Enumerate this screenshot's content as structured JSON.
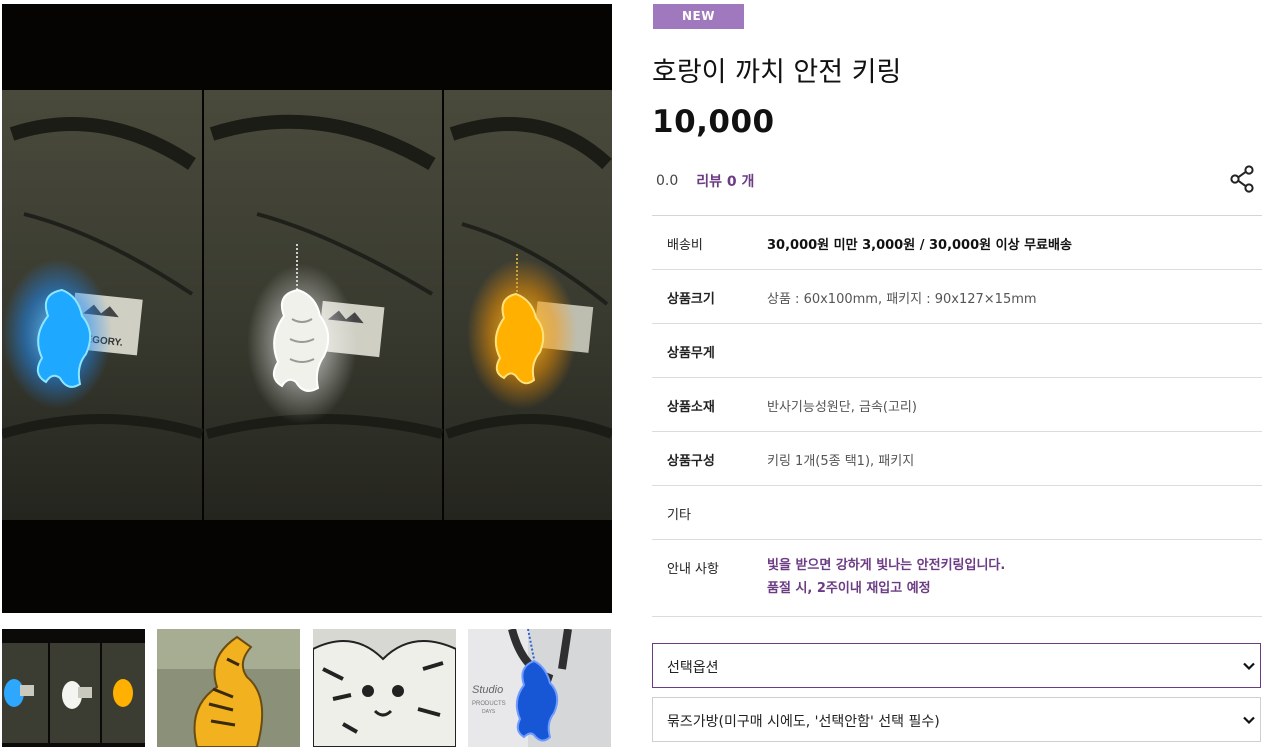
{
  "product": {
    "badge": "NEW",
    "title": "호랑이 까치 안전 키링",
    "price": "10,000",
    "rating": "0.0",
    "review_label": "리뷰 0 개"
  },
  "specs": [
    {
      "label": "배송비",
      "value": "30,000원 미만 3,000원 / 30,000원 이상 무료배송"
    },
    {
      "label": "상품크기",
      "value": "상품 : 60x100mm, 패키지 : 90x127×15mm"
    },
    {
      "label": "상품무게",
      "value": ""
    },
    {
      "label": "상품소재",
      "value": "반사기능성원단, 금속(고리)"
    },
    {
      "label": "상품구성",
      "value": "키링 1개(5종 택1), 패키지"
    },
    {
      "label": "기타",
      "value": ""
    },
    {
      "label": "안내 사항",
      "value_line1": "빛을 받으면 강하게 빛나는 안전키링입니다.",
      "value_line2": "품절 시, 2주이내 재입고 예정"
    }
  ],
  "options": {
    "select_option": "선택옵션",
    "select_bag": "묶즈가방(미구매 시에도, '선택안함' 선택 필수)"
  },
  "photo": {
    "bag_logo": "REGORY.",
    "thumb4_text_1": "Studio",
    "thumb4_text_2": "PRODUCTS",
    "thumb4_text_3": "DAYS"
  },
  "icons": {
    "share": "share-icon",
    "select_arrow": "chevron-down-icon"
  },
  "colors": {
    "accent": "#6b3b84",
    "badge": "#a078be",
    "glow_blue": "#2ea8ff",
    "glow_yellow": "#ffb400"
  }
}
